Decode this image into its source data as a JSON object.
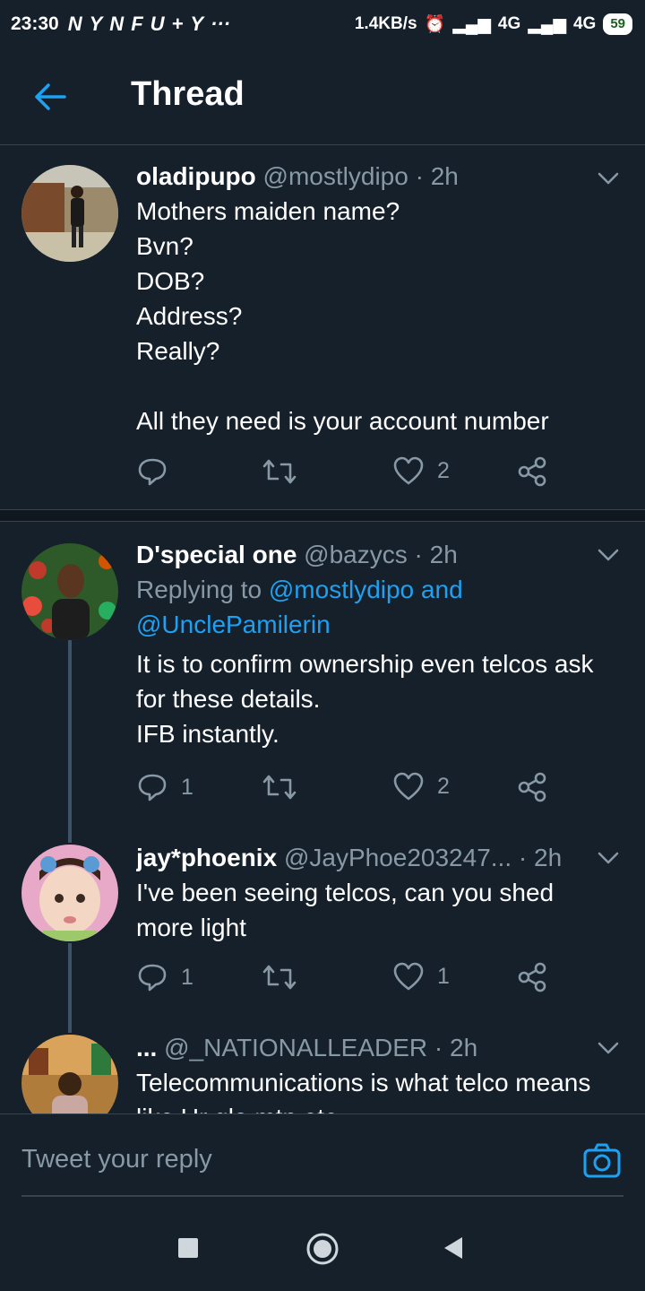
{
  "status_bar": {
    "time": "23:30",
    "notifications": [
      "N",
      "Y",
      "N",
      "F",
      "U",
      "+",
      "Y",
      "···"
    ],
    "speed": "1.4KB/s",
    "network1": "4G",
    "network2": "4G",
    "battery": "59"
  },
  "header": {
    "title": "Thread",
    "accent_color": "#1da1f2"
  },
  "tweets": [
    {
      "name": "oladipupo",
      "handle": "@mostlydipo",
      "time": "· 2h",
      "text": "Mothers maiden name?\nBvn?\nDOB?\nAddress?\nReally?\n\nAll they need is your account number",
      "reply_count": "",
      "like_count": "2"
    },
    {
      "name": "D'special one",
      "handle": "@bazycs",
      "time": "· 2h",
      "replying_prefix": "Replying to",
      "replying_user1": "@mostlydipo",
      "replying_and": "and",
      "replying_user2": "@UnclePamilerin",
      "text": "It is to confirm ownership even telcos ask for these details.\nIFB instantly.",
      "reply_count": "1",
      "like_count": "2"
    },
    {
      "name": "jay*phoenix",
      "handle": "@JayPhoe203247...",
      "time": "· 2h",
      "text": "I've been seeing telcos, can you shed more light",
      "reply_count": "1",
      "like_count": "1"
    },
    {
      "name": "...",
      "handle": "@_NATIONALLEADER",
      "time": "· 2h",
      "text": "Telecommunications is what telco means like Ur glo mtn etc"
    }
  ],
  "reply_bar": {
    "placeholder": "Tweet your reply"
  },
  "icons": [
    "back-arrow-icon",
    "chevron-down-icon",
    "reply-icon",
    "retweet-icon",
    "like-icon",
    "share-icon",
    "camera-icon",
    "nav-recents-icon",
    "nav-home-icon",
    "nav-back-icon"
  ]
}
